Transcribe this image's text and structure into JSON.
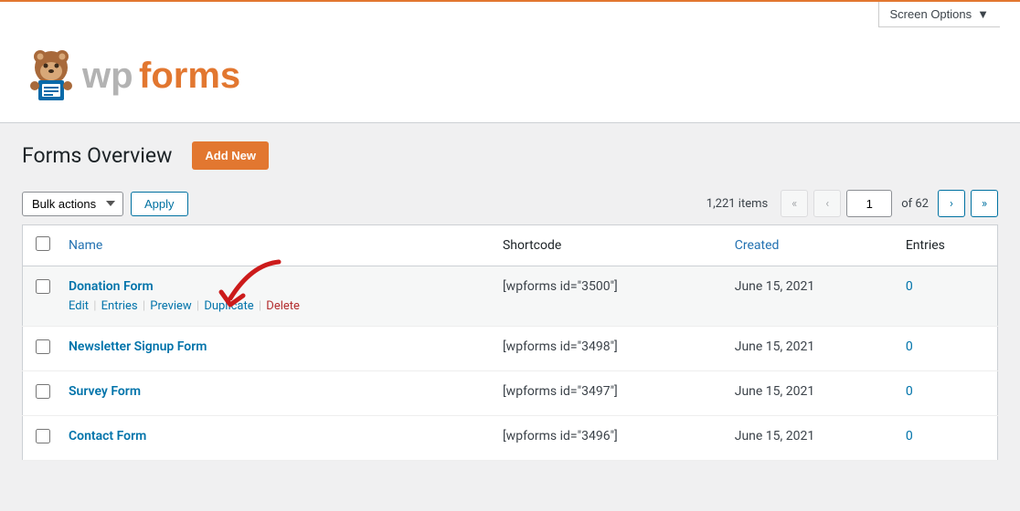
{
  "header": {
    "screen_options": "Screen Options",
    "logo_text": "wpforms",
    "page_title": "Forms Overview",
    "add_new": "Add New"
  },
  "controls": {
    "bulk_actions": "Bulk actions",
    "apply": "Apply"
  },
  "pagination": {
    "total_items": "1,221 items",
    "current_page": "1",
    "of_text": "of 62",
    "first": "«",
    "prev": "‹",
    "next": "›",
    "last": "»"
  },
  "columns": {
    "name": "Name",
    "shortcode": "Shortcode",
    "created": "Created",
    "entries": "Entries"
  },
  "row_actions": {
    "edit": "Edit",
    "entries": "Entries",
    "preview": "Preview",
    "duplicate": "Duplicate",
    "delete": "Delete"
  },
  "forms": [
    {
      "name": "Donation Form",
      "shortcode": "[wpforms id=\"3500\"]",
      "created": "June 15, 2021",
      "entries": "0",
      "show_actions": true
    },
    {
      "name": "Newsletter Signup Form",
      "shortcode": "[wpforms id=\"3498\"]",
      "created": "June 15, 2021",
      "entries": "0",
      "show_actions": false
    },
    {
      "name": "Survey Form",
      "shortcode": "[wpforms id=\"3497\"]",
      "created": "June 15, 2021",
      "entries": "0",
      "show_actions": false
    },
    {
      "name": "Contact Form",
      "shortcode": "[wpforms id=\"3496\"]",
      "created": "June 15, 2021",
      "entries": "0",
      "show_actions": false
    }
  ]
}
